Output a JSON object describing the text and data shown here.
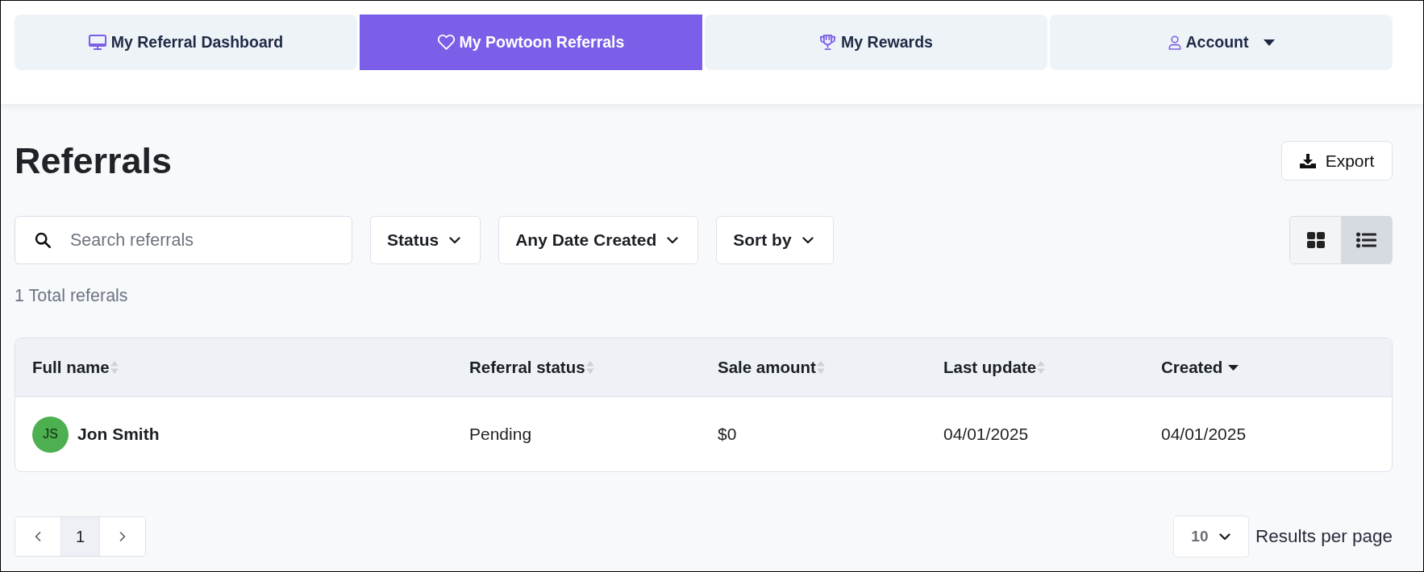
{
  "nav_tabs": [
    {
      "kind": "dashboard",
      "label": "My Referral Dashboard",
      "selected": false
    },
    {
      "kind": "referrals",
      "label": "My Powtoon Referrals",
      "selected": true
    },
    {
      "kind": "rewards",
      "label": "My Rewards",
      "selected": false
    },
    {
      "kind": "account",
      "label": "Account",
      "selected": false
    }
  ],
  "header": {
    "title": "Referrals",
    "export_button": "Export"
  },
  "filters": {
    "search": {
      "placeholder": "Search referrals"
    },
    "dropdowns": [
      {
        "label": "Status"
      },
      {
        "label": "Any Date Created"
      },
      {
        "label": "Sort by"
      }
    ]
  },
  "view_toggle": [
    {
      "kind": "grid",
      "selected": false
    },
    {
      "kind": "list",
      "selected": true
    }
  ],
  "total_count": "1 Total referals",
  "table": {
    "columns": [
      {
        "label": "Full name",
        "sorted": false
      },
      {
        "label": "Referral status",
        "sorted": false
      },
      {
        "label": "Sale amount",
        "sorted": false
      },
      {
        "label": "Last update",
        "sorted": false
      },
      {
        "label": "Created",
        "sorted": true
      }
    ],
    "rows": [
      {
        "initials": "JS",
        "color": "#4caf50",
        "full_name": "Jon Smith",
        "referral_status": "Pending",
        "sale_amount": "$0",
        "last_update": "04/01/2025",
        "created": "04/01/2025"
      }
    ]
  },
  "pagination": {
    "pages": [
      {
        "label": "1",
        "selected": true
      }
    ]
  },
  "per_page": {
    "value": "10",
    "label": "Results per page"
  }
}
